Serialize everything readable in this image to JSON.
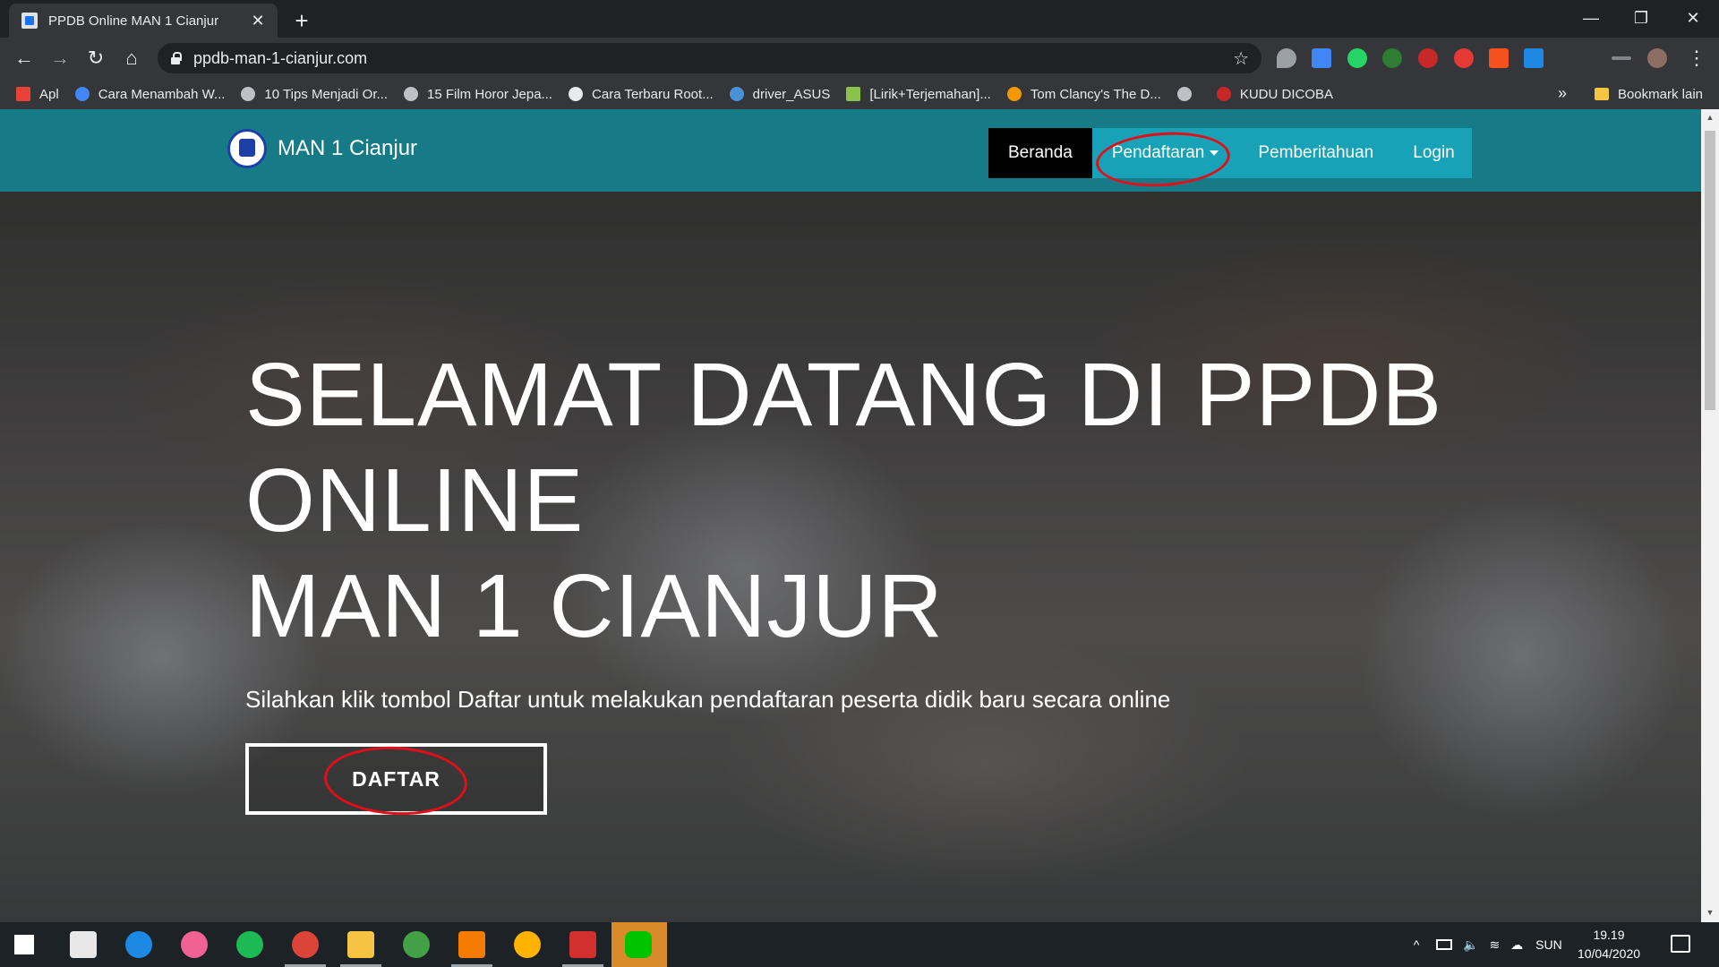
{
  "browser": {
    "tab_title": "PPDB Online MAN 1 Cianjur",
    "tab_close": "✕",
    "new_tab": "+",
    "url": "ppdb-man-1-cianjur.com",
    "window": {
      "minimize": "—",
      "restore": "❐",
      "close": "✕"
    },
    "nav": {
      "back": "←",
      "forward": "→",
      "reload": "↻",
      "home": "⌂",
      "star": "☆",
      "menu": "⋮"
    }
  },
  "bookmarks": {
    "items": [
      {
        "label": "Apl",
        "color": "#ea4335"
      },
      {
        "label": "Cara Menambah W...",
        "color": "#4285f4"
      },
      {
        "label": "10 Tips Menjadi Or...",
        "color": "#bdc1c6"
      },
      {
        "label": "15 Film Horor Jepa...",
        "color": "#bdc1c6"
      },
      {
        "label": "Cara Terbaru Root...",
        "color": "#e8eaed"
      },
      {
        "label": "driver_ASUS",
        "color": "#4a90d9"
      },
      {
        "label": "[Lirik+Terjemahan]...",
        "color": "#8bc34a"
      },
      {
        "label": "Tom Clancy's The D...",
        "color": "#f29900"
      },
      {
        "label": "",
        "color": "#bdc1c6"
      },
      {
        "label": "KUDU DICOBA",
        "color": "#c62828"
      }
    ],
    "overflow": "»",
    "other": "Bookmark lain"
  },
  "site": {
    "brand": "MAN 1 Cianjur",
    "nav": {
      "home": "Beranda",
      "register": "Pendaftaran",
      "announce": "Pemberitahuan",
      "login": "Login"
    },
    "hero": {
      "line1": "SELAMAT DATANG DI PPDB",
      "line2": "ONLINE",
      "line3": "MAN 1 CIANJUR",
      "subtitle": "Silahkan klik tombol Daftar untuk melakukan pendaftaran peserta didik baru secara online",
      "button": "DAFTAR"
    }
  },
  "taskbar": {
    "tray_lang": "SUN",
    "time": "19.19",
    "date": "10/04/2020"
  },
  "colors": {
    "navbar": "#167b87",
    "navmenu": "#17a2b8",
    "annotation": "#e0101a"
  }
}
